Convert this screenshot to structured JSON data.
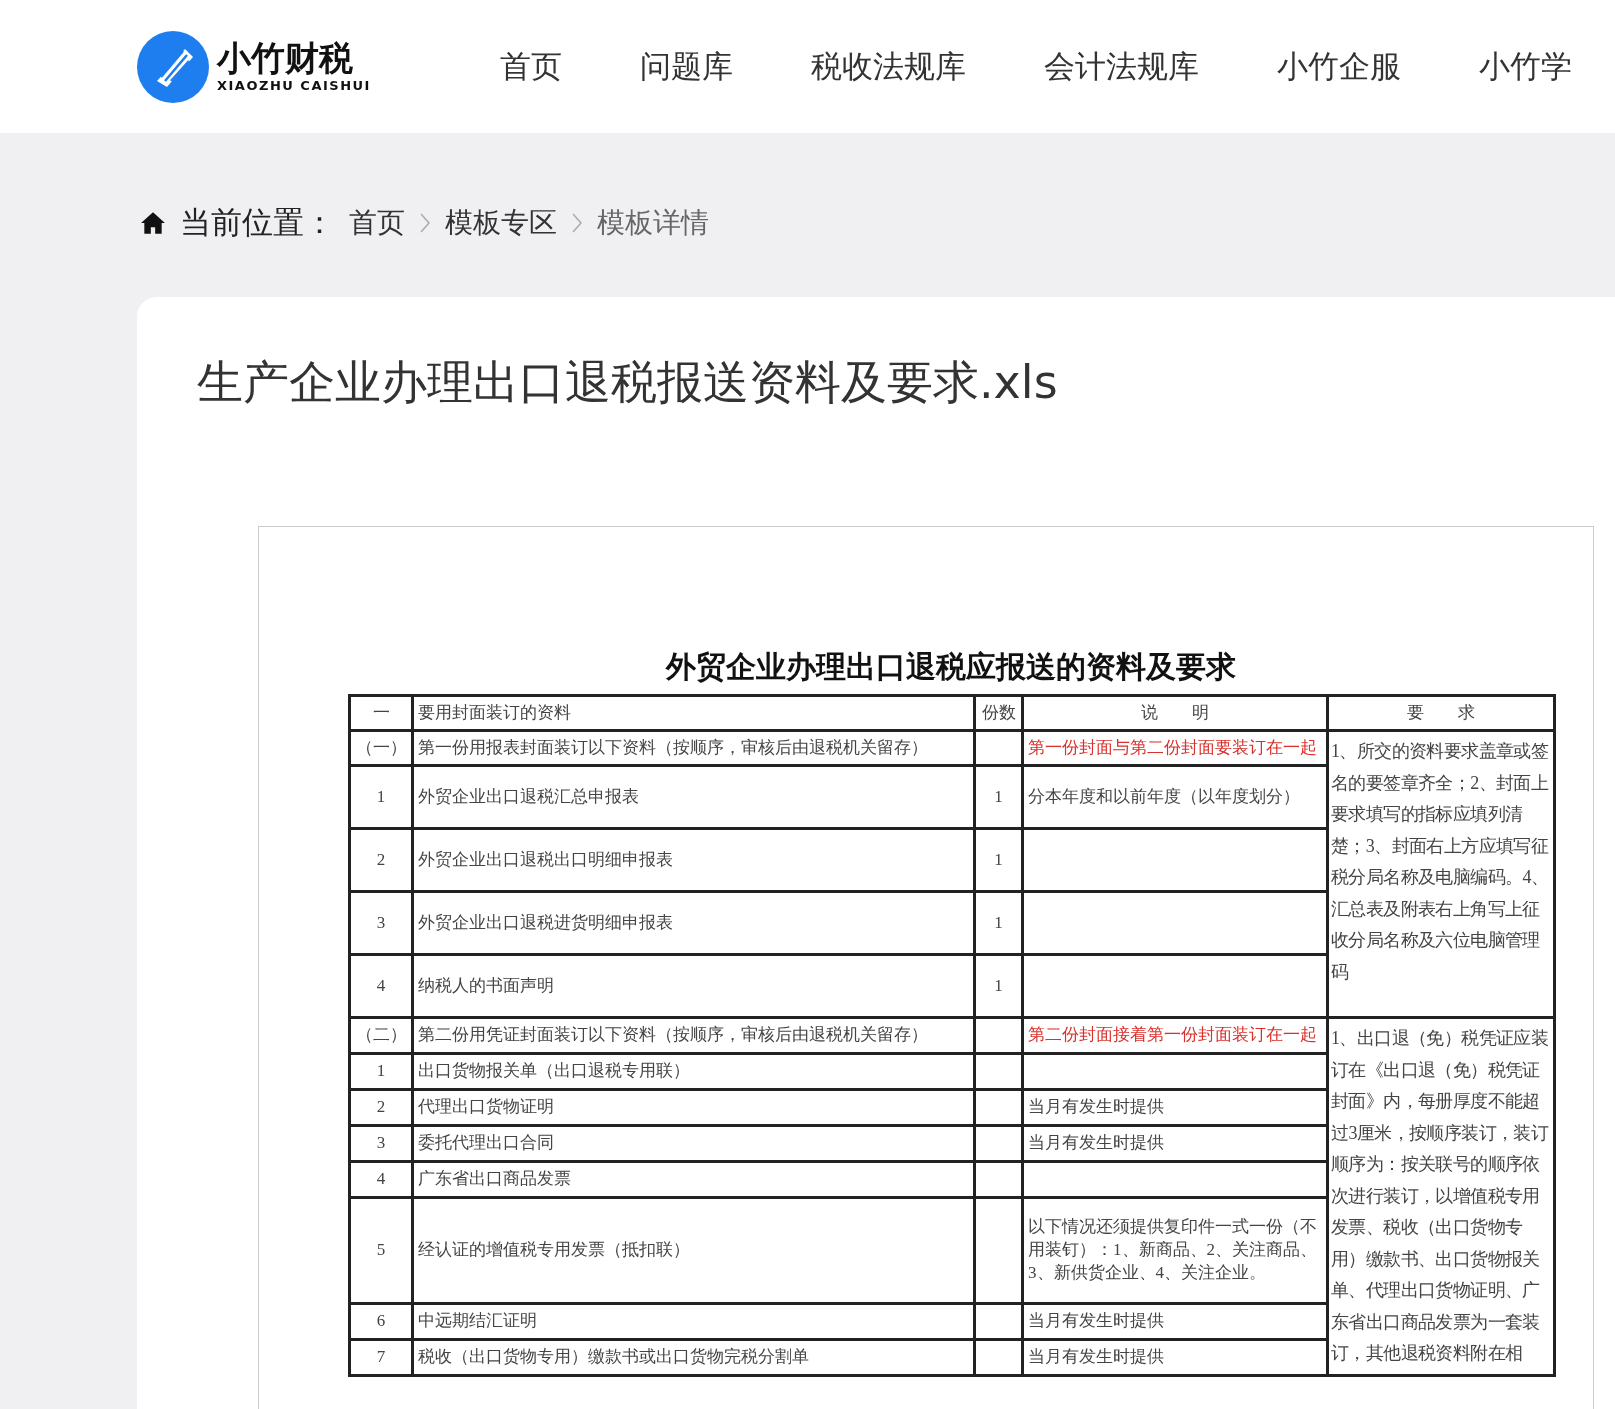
{
  "header": {
    "logo": {
      "name": "小竹财税",
      "subtitle": "XIAOZHU CAISHUI"
    },
    "nav": [
      "首页",
      "问题库",
      "税收法规库",
      "会计法规库",
      "小竹企服",
      "小竹学"
    ]
  },
  "breadcrumb": {
    "label": "当前位置：",
    "items": [
      "首页",
      "模板专区",
      "模板详情"
    ]
  },
  "document": {
    "title": "生产企业办理出口退税报送资料及要求.xls",
    "sheet": {
      "title": "外贸企业办理出口退税应报送的资料及要求",
      "header": [
        "一",
        "要用封面装订的资料",
        "份数",
        "说　　明",
        "要　　求"
      ],
      "sections": [
        {
          "number": "（一）",
          "heading": "第一份用报表封面装订以下资料（按顺序，审核后由退税机关留存）",
          "description": "第一份封面与第二份封面要装订在一起",
          "description_highlighted": true,
          "requirements": "1、所交的资料要求盖章或签名的要签章齐全；2、封面上要求填写的指标应填列清楚；3、封面右上方应填写征税分局名称及电脑编码。4、汇总表及附表右上角写上征收分局名称及六位电脑管理码",
          "items": [
            {
              "number": "1",
              "name": "外贸企业出口退税汇总申报表",
              "copies": "1",
              "description": "分本年度和以前年度（以年度划分）"
            },
            {
              "number": "2",
              "name": "外贸企业出口退税出口明细申报表",
              "copies": "1"
            },
            {
              "number": "3",
              "name": "外贸企业出口退税进货明细申报表",
              "copies": "1"
            },
            {
              "number": "4",
              "name": "纳税人的书面声明",
              "copies": "1"
            }
          ]
        },
        {
          "number": "（二）",
          "heading": "第二份用凭证封面装订以下资料（按顺序，审核后由退税机关留存）",
          "description": "第二份封面接着第一份封面装订在一起",
          "description_highlighted": true,
          "requirements": "1、出口退（免）税凭证应装订在《出口退（免）税凭证封面》内，每册厚度不能超过3厘米，按顺序装订，装订顺序为：按关联号的顺序依次进行装订，以增值税专用发票、税收（出口货物专用）缴款书、出口货物报关单、代理出口货物证明、广东省出口商品发票为一套装订，其他退税资料附在相",
          "items": [
            {
              "number": "1",
              "name": "出口货物报关单（出口退税专用联）"
            },
            {
              "number": "2",
              "name": "代理出口货物证明",
              "description": "当月有发生时提供"
            },
            {
              "number": "3",
              "name": "委托代理出口合同",
              "description": "当月有发生时提供"
            },
            {
              "number": "4",
              "name": "广东省出口商品发票"
            },
            {
              "number": "5",
              "name": "经认证的增值税专用发票（抵扣联）",
              "description": "以下情况还须提供复印件一式一份（不用装钉）：1、新商品、2、关注商品、3、新供货企业、4、关注企业。"
            },
            {
              "number": "6",
              "name": "中远期结汇证明",
              "description": "当月有发生时提供"
            },
            {
              "number": "7",
              "name": "税收（出口货物专用）缴款书或出口货物完税分割单",
              "description": "当月有发生时提供"
            }
          ]
        }
      ]
    }
  }
}
